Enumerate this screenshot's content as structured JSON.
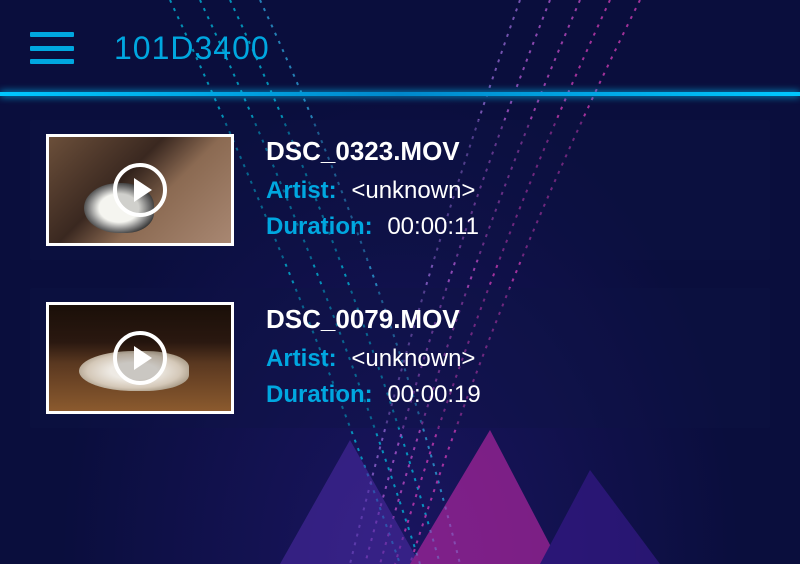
{
  "header": {
    "title": "101D3400"
  },
  "labels": {
    "artist": "Artist:",
    "duration": "Duration:"
  },
  "items": [
    {
      "filename": "DSC_0323.MOV",
      "artist": "<unknown>",
      "duration": "00:00:11"
    },
    {
      "filename": "DSC_0079.MOV",
      "artist": "<unknown>",
      "duration": "00:00:19"
    }
  ]
}
